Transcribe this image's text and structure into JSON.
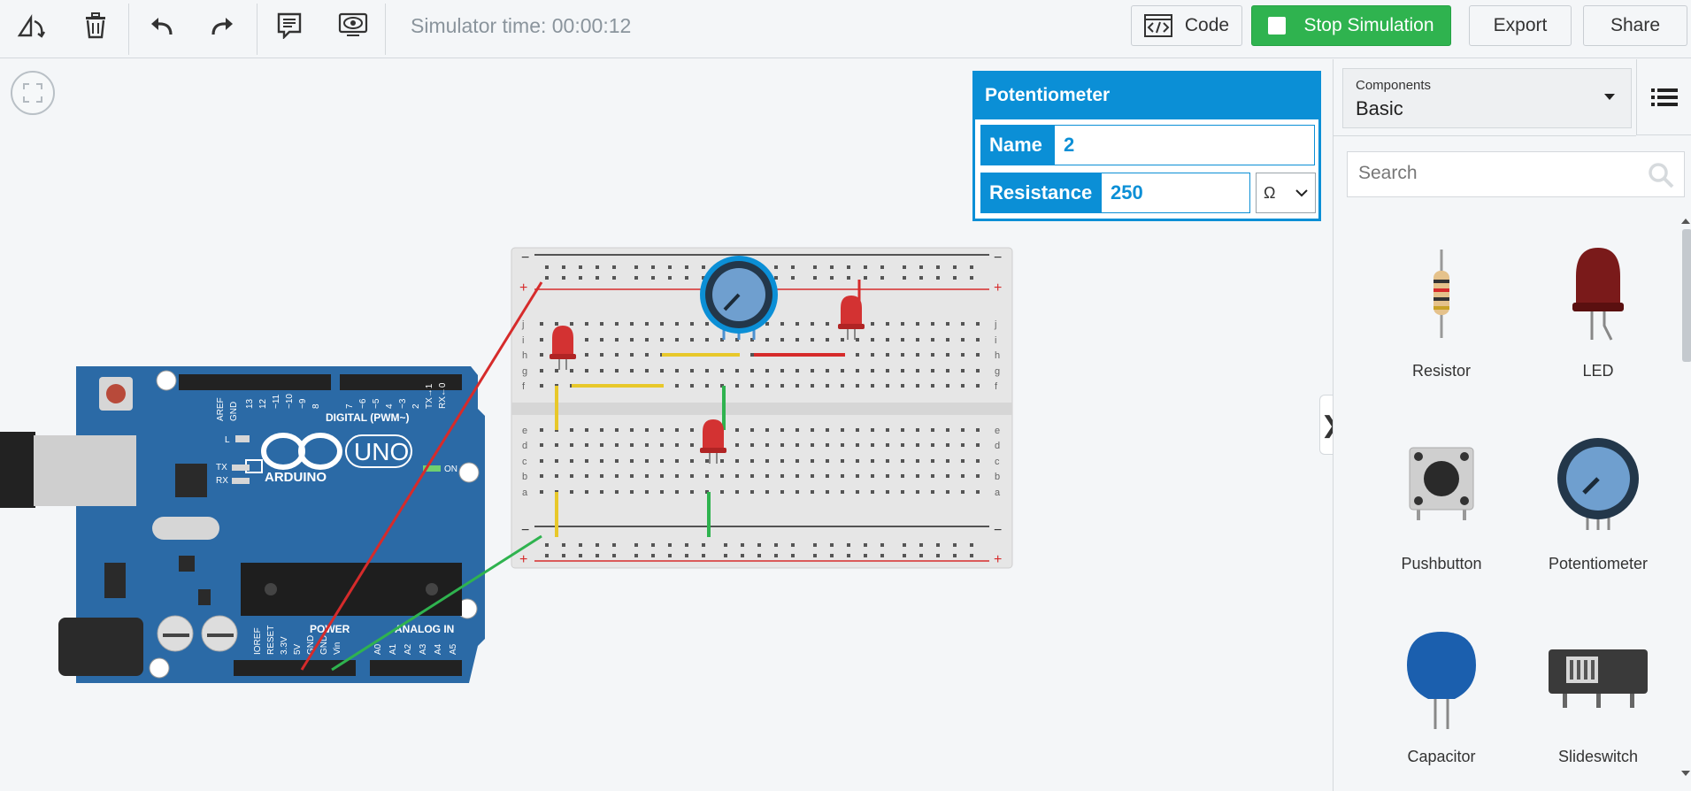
{
  "toolbar": {
    "sim_time": "Simulator time: 00:00:12",
    "code_label": "Code",
    "stop_label": "Stop Simulation",
    "export_label": "Export",
    "share_label": "Share"
  },
  "inspector": {
    "title": "Potentiometer",
    "name_label": "Name",
    "name_value": "2",
    "resistance_label": "Resistance",
    "resistance_value": "250",
    "unit": "Ω"
  },
  "panel": {
    "components_small": "Components",
    "components_value": "Basic",
    "search_placeholder": "Search",
    "items": [
      {
        "label": "Resistor"
      },
      {
        "label": "LED"
      },
      {
        "label": "Pushbutton"
      },
      {
        "label": "Potentiometer"
      },
      {
        "label": "Capacitor"
      },
      {
        "label": "Slideswitch"
      }
    ]
  },
  "arduino": {
    "brand": "ARDUINO",
    "model": "UNO",
    "digital": "DIGITAL (PWM~)",
    "power": "POWER",
    "analog": "ANALOG IN",
    "aref": "AREF",
    "gnd": "GND",
    "on": "ON",
    "l": "L",
    "tx": "TX",
    "rx": "RX",
    "power_pins": [
      "IOREF",
      "RESET",
      "3.3V",
      "5V",
      "GND",
      "GND",
      "Vin"
    ],
    "analog_pins": [
      "A0",
      "A1",
      "A2",
      "A3",
      "A4",
      "A5"
    ],
    "digital_pins": [
      "13",
      "12",
      "~11",
      "~10",
      "~9",
      "8",
      "7",
      "~6",
      "~5",
      "4",
      "~3",
      "2",
      "TX→1",
      "RX←0"
    ]
  },
  "breadboard": {
    "minus": "−",
    "plus": "+",
    "rows_top": [
      "j",
      "i",
      "h",
      "g",
      "f"
    ],
    "rows_bottom": [
      "e",
      "d",
      "c",
      "b",
      "a"
    ]
  },
  "colors": {
    "accent": "#0b8fd6",
    "stop": "#2fb34f",
    "wire_red": "#d62b2b",
    "wire_green": "#2fb34f",
    "wire_yellow": "#e8c82a",
    "board": "#2b6aa6"
  }
}
